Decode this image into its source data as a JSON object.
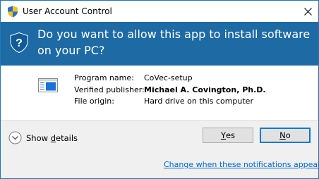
{
  "window": {
    "title": "User Account Control",
    "close_icon": "close-icon",
    "title_icon": "uac-shield-icon"
  },
  "banner": {
    "question": "Do you want to allow this app to install software on your PC?",
    "icon": "help-shield-icon",
    "background_color": "#1e6aa4"
  },
  "details": {
    "program_icon": "installer-icon",
    "rows": [
      {
        "label": "Program name:",
        "value": "CoVec-setup"
      },
      {
        "label": "Verified publisher:",
        "value": "Michael A. Covington, Ph.D."
      },
      {
        "label": "File origin:",
        "value": "Hard drive on this computer"
      }
    ]
  },
  "footer": {
    "show_details": {
      "pre": "Show ",
      "accel": "d",
      "post": "etails"
    },
    "yes_button": {
      "accel": "Y",
      "rest": "es"
    },
    "no_button": {
      "accel": "N",
      "rest": "o"
    },
    "notification_link": "Change when these notifications appear",
    "link_color": "#0066cc"
  }
}
